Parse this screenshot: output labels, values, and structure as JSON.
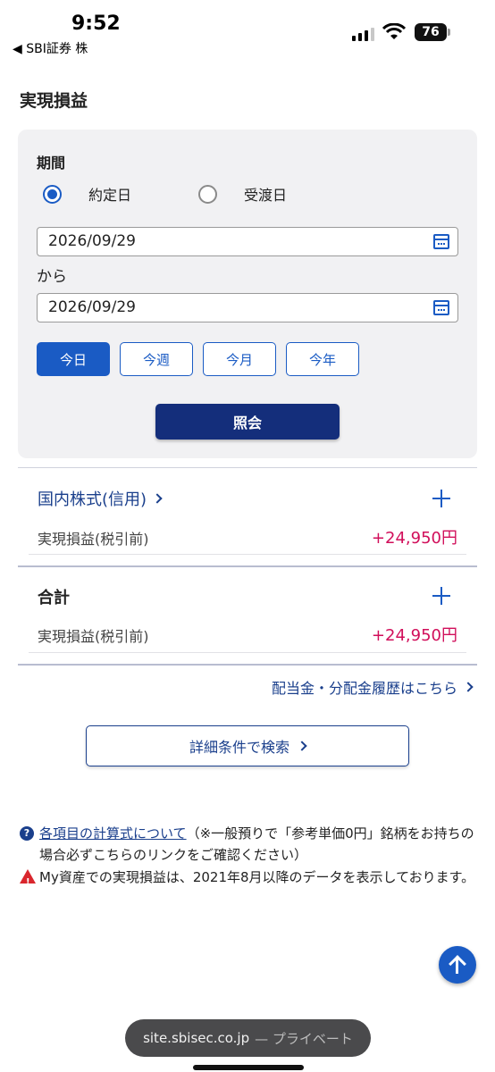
{
  "status_bar": {
    "time": "9:52",
    "back_app": "◀ SBI証券 株",
    "battery": "76"
  },
  "page_title": "実現損益",
  "filter": {
    "period_label": "期間",
    "radio_trade_date": "約定日",
    "radio_settlement_date": "受渡日",
    "selected": "約定日",
    "from_date": "2026/09/29",
    "kara": "から",
    "to_date": "2026/09/29",
    "quick_buttons": [
      "今日",
      "今週",
      "今月",
      "今年"
    ],
    "active_quick": "今日",
    "submit_label": "照会"
  },
  "sections": [
    {
      "title": "国内株式(信用)",
      "row_label": "実現損益(税引前)",
      "row_value": "+24,950円"
    },
    {
      "title": "合計",
      "row_label": "実現損益(税引前)",
      "row_value": "+24,950円"
    }
  ],
  "dividend_link": "配当金・分配金履歴はこちら",
  "search_button": "詳細条件で検索",
  "notes": {
    "formula_link": "各項目の計算式について",
    "formula_text": "（※一般預りで「参考単価0円」銘柄をお持ちの場合必ずこちらのリンクをご確認ください）",
    "warning_text": "My資産での実現損益は、2021年8月以降のデータを表示しております。"
  },
  "browser": {
    "url": "site.sbisec.co.jp",
    "private_label": "— プライベート"
  },
  "colors": {
    "accent": "#1a5bc4",
    "navy": "#142e7b",
    "profit": "#d10e5a",
    "panel_bg": "#f1f1f3"
  }
}
